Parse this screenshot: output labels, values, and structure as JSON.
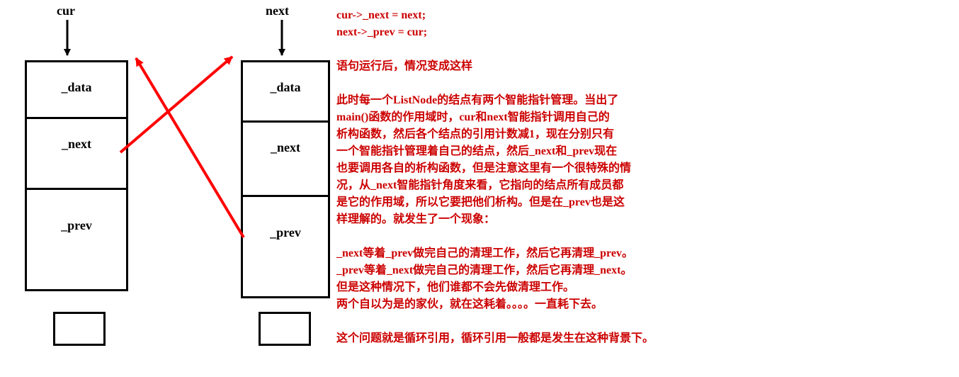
{
  "labels": {
    "cur": "cur",
    "next": "next"
  },
  "node": {
    "data": "_data",
    "next": "_next",
    "prev": "_prev"
  },
  "code": {
    "line1": "cur->_next = next;",
    "line2": "next->_prev = cur;"
  },
  "text": {
    "line3": "语句运行后，情况变成这样",
    "line4": "此时每一个ListNode的结点有两个智能指针管理。当出了",
    "line5": "main()函数的作用域时，cur和next智能指针调用自己的",
    "line6": "析构函数，然后各个结点的引用计数减1，现在分别只有",
    "line7": "一个智能指针管理着自己的结点，然后_next和_prev现在",
    "line8": "也要调用各自的析构函数，但是注意这里有一个很特殊的情",
    "line9": "况，从_next智能指针角度来看，它指向的结点所有成员都",
    "line10": "是它的作用域，所以它要把他们析构。但是在_prev也是这",
    "line11": "样理解的。就发生了一个现象：",
    "line12": "_next等着_prev做完自己的清理工作，然后它再清理_prev。",
    "line13": "_prev等着_next做完自己的清理工作，然后它再清理_next。",
    "line14": "但是这种情况下，他们谁都不会先做清理工作。",
    "line15": "两个自以为是的家伙，就在这耗着。。。。一直耗下去。",
    "line16": "这个问题就是循环引用，循环引用一般都是发生在这种背景下。"
  }
}
